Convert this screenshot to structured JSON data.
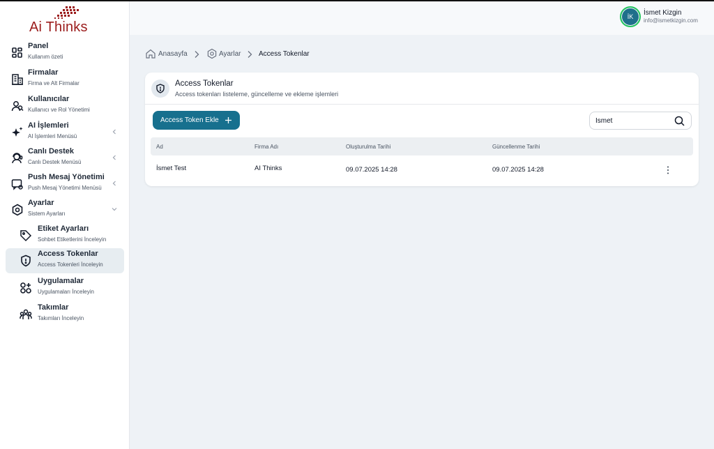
{
  "brand": {
    "logo_text": "Ai Thinks",
    "color": "#9b1c1c"
  },
  "user": {
    "initials": "İK",
    "name": "İsmet Kizgin",
    "email": "info@ismetkizgin.com"
  },
  "sidebar": {
    "items": [
      {
        "title": "Panel",
        "desc": "Kullanım özeti",
        "icon": "dashboard-icon"
      },
      {
        "title": "Firmalar",
        "desc": "Firma ve Alt Firmalar",
        "icon": "building-icon"
      },
      {
        "title": "Kullanıcılar",
        "desc": "Kullanıcı ve Rol Yönetimi",
        "icon": "users-icon"
      },
      {
        "title": "AI İşlemleri",
        "desc": "AI İşlemleri Menüsü",
        "icon": "sparkle-icon"
      },
      {
        "title": "Canlı Destek",
        "desc": "Canlı Destek Menüsü",
        "icon": "support-icon"
      },
      {
        "title": "Push Mesaj Yönetimi",
        "desc": "Push Mesaj Yönetimi Menüsü",
        "icon": "message-icon"
      },
      {
        "title": "Ayarlar",
        "desc": "Sistem Ayarları",
        "icon": "settings-icon"
      }
    ],
    "subitems": [
      {
        "title": "Etiket Ayarları",
        "desc": "Sohbet Etiketlerini İnceleyin",
        "icon": "tag-icon"
      },
      {
        "title": "Access Tokenlar",
        "desc": "Access Tokenleri İnceleyin",
        "icon": "shield-icon"
      },
      {
        "title": "Uygulamalar",
        "desc": "Uygulamaları İnceleyin",
        "icon": "apps-icon"
      },
      {
        "title": "Takımlar",
        "desc": "Takımları İnceleyin",
        "icon": "team-icon"
      }
    ]
  },
  "breadcrumb": {
    "home": "Anasayfa",
    "settings": "Ayarlar",
    "current": "Access Tokenlar"
  },
  "card": {
    "title": "Access Tokenlar",
    "subtitle": "Access tokenları listeleme, güncelleme ve ekleme işlemleri",
    "add_button": "Access Token Ekle"
  },
  "search": {
    "value": "İsmet",
    "placeholder": ""
  },
  "table": {
    "headers": [
      "Ad",
      "Firma Adı",
      "Oluşturulma Tarihi",
      "Güncellenme Tarihi"
    ],
    "rows": [
      [
        "İsmet Test",
        "AI Thinks",
        "09.07.2025 14:28",
        "09.07.2025 14:28"
      ]
    ]
  },
  "colors": {
    "accent": "#17708e",
    "active_bg": "#e7edf1",
    "online": "#22c55e"
  }
}
